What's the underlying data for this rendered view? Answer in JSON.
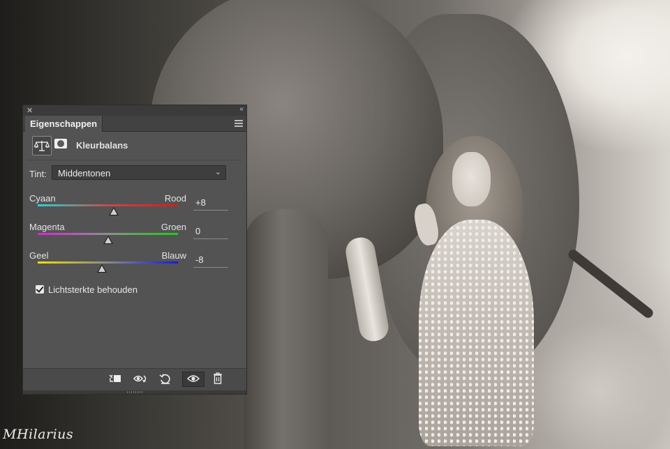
{
  "panel": {
    "tab_label": "Eigenschappen",
    "adjustment_title": "Kleurbalans",
    "tint": {
      "label": "Tint:",
      "value": "Middentonen"
    },
    "sliders": [
      {
        "left": "Cyaan",
        "right": "Rood",
        "value": "+8",
        "level": 8,
        "gradient": [
          "#20d6d8",
          "#c84a4a",
          "#e01818"
        ]
      },
      {
        "left": "Magenta",
        "right": "Groen",
        "value": "0",
        "level": 0,
        "gradient": [
          "#e020e0",
          "#8f8f8f",
          "#16d016"
        ]
      },
      {
        "left": "Geel",
        "right": "Blauw",
        "value": "-8",
        "level": -8,
        "gradient": [
          "#f0e000",
          "#8a8a8a",
          "#1418e8"
        ]
      }
    ],
    "preserve_luminosity": {
      "label": "Lichtsterkte behouden",
      "checked": true
    },
    "footer_icons": [
      "clip-to-layer-icon",
      "view-previous-icon",
      "reset-icon",
      "visibility-eye-icon",
      "trash-icon"
    ]
  },
  "watermark": "MHilarius"
}
